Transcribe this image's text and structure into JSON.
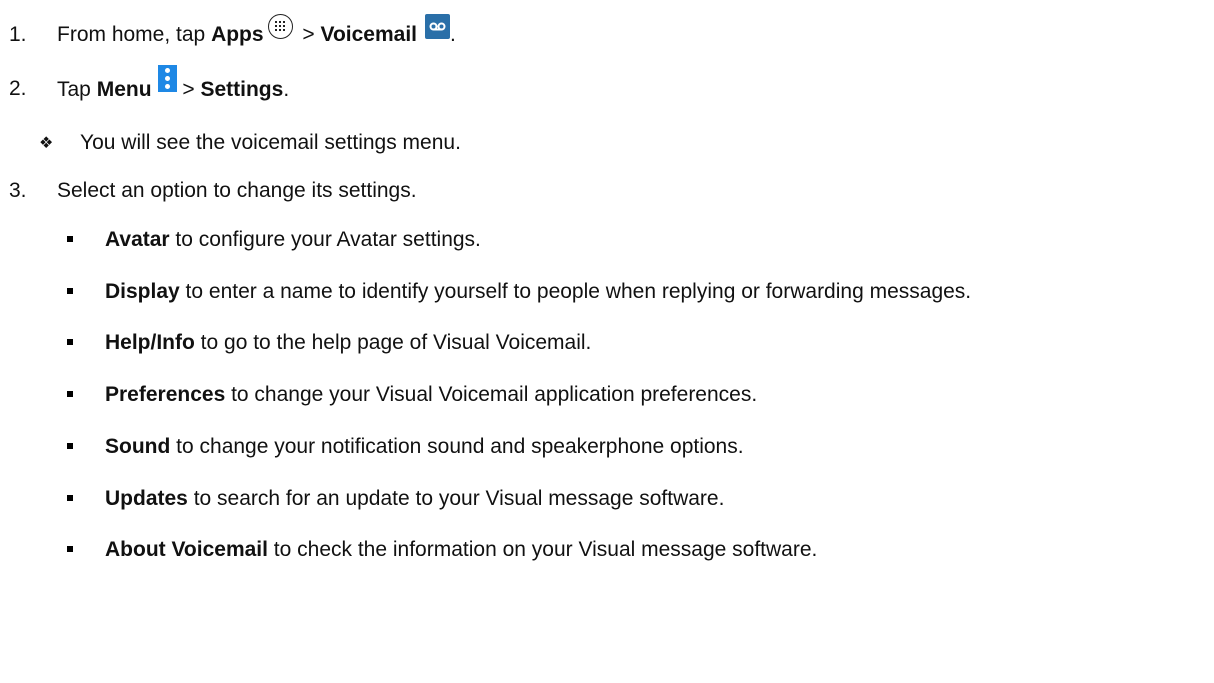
{
  "steps": [
    {
      "number": "1.",
      "prefix": "From home, tap ",
      "bold1": "Apps",
      "sep": " > ",
      "bold2": "Voicemail",
      "suffix": "."
    },
    {
      "number": "2.",
      "prefix": "Tap ",
      "bold1": "Menu",
      "sep": " > ",
      "bold2": "Settings",
      "suffix": "."
    },
    {
      "number": "3.",
      "text": "Select an option to change its settings."
    }
  ],
  "note": {
    "bullet": "❖",
    "text": "You will see the voicemail settings menu."
  },
  "options": [
    {
      "term": "Avatar",
      "desc": " to configure your Avatar settings."
    },
    {
      "term": "Display",
      "desc": " to enter a name to identify yourself to people when replying or forwarding messages."
    },
    {
      "term": "Help/Info",
      "desc": " to go to the help page of Visual Voicemail."
    },
    {
      "term": "Preferences",
      "desc": " to change your Visual Voicemail application preferences."
    },
    {
      "term": "Sound",
      "desc": " to change your notification sound and speakerphone options."
    },
    {
      "term": "Updates",
      "desc": " to search for an update to your Visual message software."
    },
    {
      "term": "About Voicemail",
      "desc": " to check the information on your Visual message software."
    }
  ],
  "icons": {
    "apps": "apps-grid-icon",
    "voicemail": "voicemail-icon",
    "menu": "menu-dots-icon"
  },
  "colors": {
    "voicemail_icon": "#2a6fa8",
    "menu_icon": "#1e88e5",
    "text": "#111111"
  }
}
